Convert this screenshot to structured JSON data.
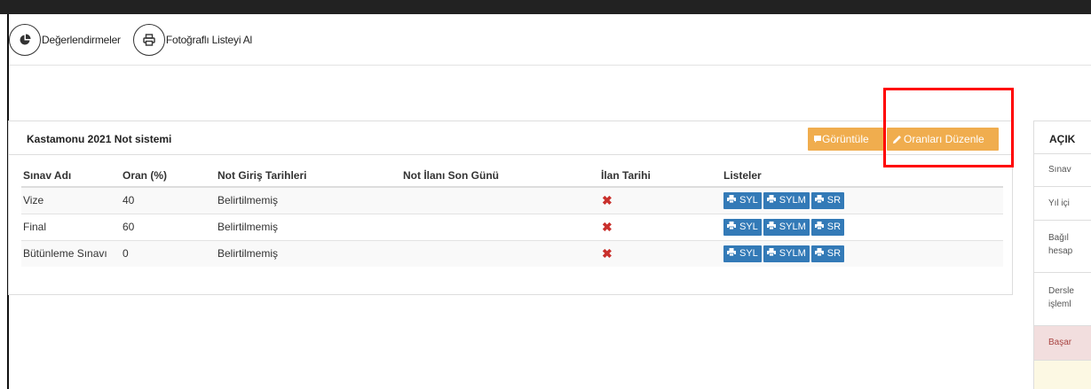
{
  "toolbar": {
    "evaluations_label": "Değerlendirmeler",
    "photo_list_label": "Fotoğraflı Listeyi Al"
  },
  "panel": {
    "title": "Kastamonu 2021 Not sistemi",
    "view_label": "Görüntüle",
    "edit_rates_label": "Oranları Düzenle"
  },
  "table": {
    "headers": {
      "exam": "Sınav Adı",
      "rate": "Oran (%)",
      "entry_dates": "Not Giriş Tarihleri",
      "announce_last": "Not İlanı Son Günü",
      "announce_date": "İlan Tarihi",
      "lists": "Listeler"
    },
    "rows": [
      {
        "exam": "Vize",
        "rate": "40",
        "entry_dates": "Belirtilmemiş",
        "announce_last": "",
        "announce_date_mark": "✖"
      },
      {
        "exam": "Final",
        "rate": "60",
        "entry_dates": "Belirtilmemiş",
        "announce_last": "",
        "announce_date_mark": "✖"
      },
      {
        "exam": "Bütünleme Sınavı",
        "rate": "0",
        "entry_dates": "Belirtilmemiş",
        "announce_last": "",
        "announce_date_mark": "✖"
      }
    ],
    "list_buttons": {
      "syl": "SYL",
      "sylm": "SYLM",
      "sr": "SR"
    }
  },
  "sidebar": {
    "title": "AÇIK",
    "items": [
      "Sınav",
      "Yıl içi",
      "Bağıl",
      "hesap",
      "Dersle",
      "işleml",
      "Başar",
      ""
    ]
  },
  "colors": {
    "orange_button": "#f0ad4e",
    "blue_button": "#337ab7",
    "highlight_box": "#ff0000",
    "danger_mark": "#c9302c"
  },
  "icons": {
    "evaluations": "pie-chart-icon",
    "photo_list": "print-icon",
    "view": "comment-icon",
    "edit": "pencil-icon",
    "list_button": "print-icon",
    "not_announced": "times-icon"
  }
}
